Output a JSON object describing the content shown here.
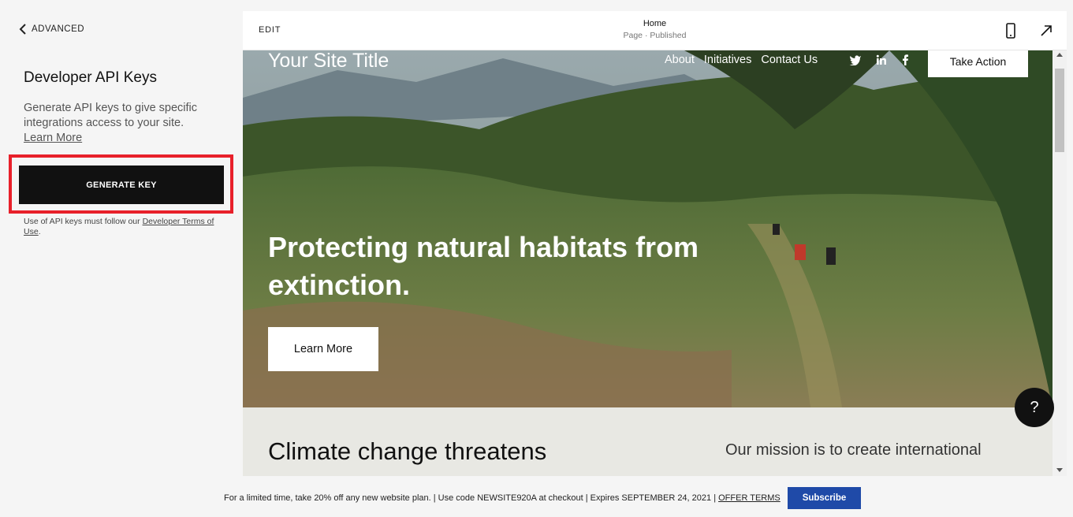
{
  "sidebar": {
    "back_label": "ADVANCED",
    "title": "Developer API Keys",
    "description": "Generate API keys to give specific integrations access to your site.",
    "learn_more": "Learn More",
    "generate_button": "GENERATE KEY",
    "terms_prefix": "Use of API keys must follow our ",
    "terms_link": "Developer Terms of Use",
    "terms_suffix": ".",
    "highlight_color": "#e8202a"
  },
  "preview": {
    "edit_label": "EDIT",
    "page_name": "Home",
    "page_status": "Page · Published",
    "icons": [
      "mobile-phone-icon",
      "expand-arrow-icon"
    ]
  },
  "site": {
    "title": "Your Site Title",
    "nav": [
      "About",
      "Initiatives",
      "Contact Us"
    ],
    "social_icons": [
      "twitter-icon",
      "linkedin-icon",
      "facebook-icon"
    ],
    "cta": "Take Action",
    "headline": "Protecting natural habitats from extinction.",
    "hero_button": "Learn More",
    "section_heading": "Climate change threatens",
    "section_text": "Our mission is to create international"
  },
  "help_label": "?",
  "promo": {
    "text": "For a limited time, take 20% off any new website plan. | Use code NEWSITE920A at checkout | Expires SEPTEMBER 24, 2021 | ",
    "offer_terms": "OFFER TERMS",
    "subscribe": "Subscribe",
    "subscribe_color": "#1f4aa8"
  }
}
